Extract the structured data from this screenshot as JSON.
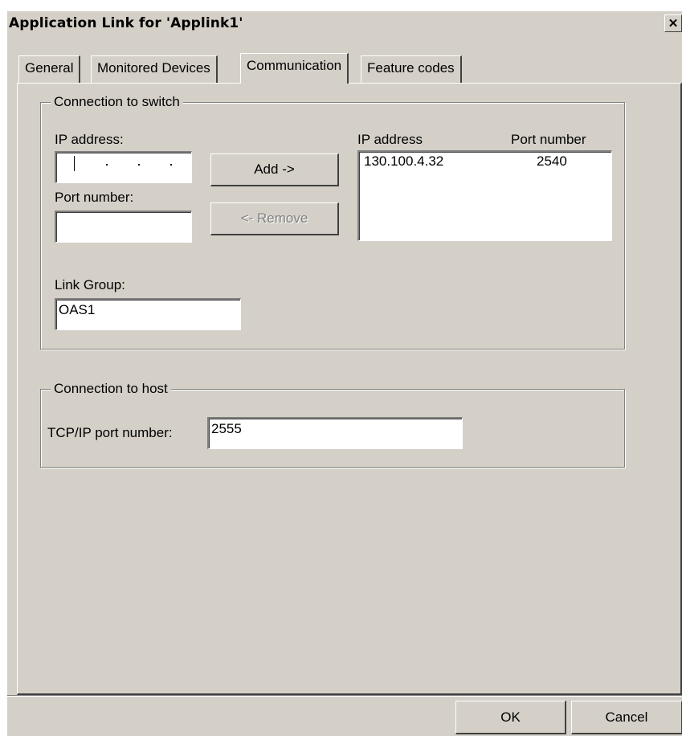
{
  "window": {
    "title": "Application Link for 'Applink1'",
    "close_glyph": "✕"
  },
  "tabs": [
    {
      "label": "General"
    },
    {
      "label": "Monitored Devices"
    },
    {
      "label": "Communication",
      "active": true
    },
    {
      "label": "Feature codes"
    }
  ],
  "switch_group": {
    "legend": "Connection to switch",
    "ip_label": "IP address:",
    "ip_value": "",
    "port_label": "Port number:",
    "port_value": "",
    "add_button": "Add ->",
    "remove_button": "<- Remove",
    "list_headers": {
      "ip": "IP address",
      "port": "Port number"
    },
    "list_rows": [
      {
        "ip": "130.100.4.32",
        "port": "2540"
      }
    ],
    "link_group_label": "Link Group:",
    "link_group_value": "OAS1"
  },
  "host_group": {
    "legend": "Connection to host",
    "tcp_label": "TCP/IP port number:",
    "tcp_value": "2555"
  },
  "footer": {
    "ok": "OK",
    "cancel": "Cancel"
  }
}
